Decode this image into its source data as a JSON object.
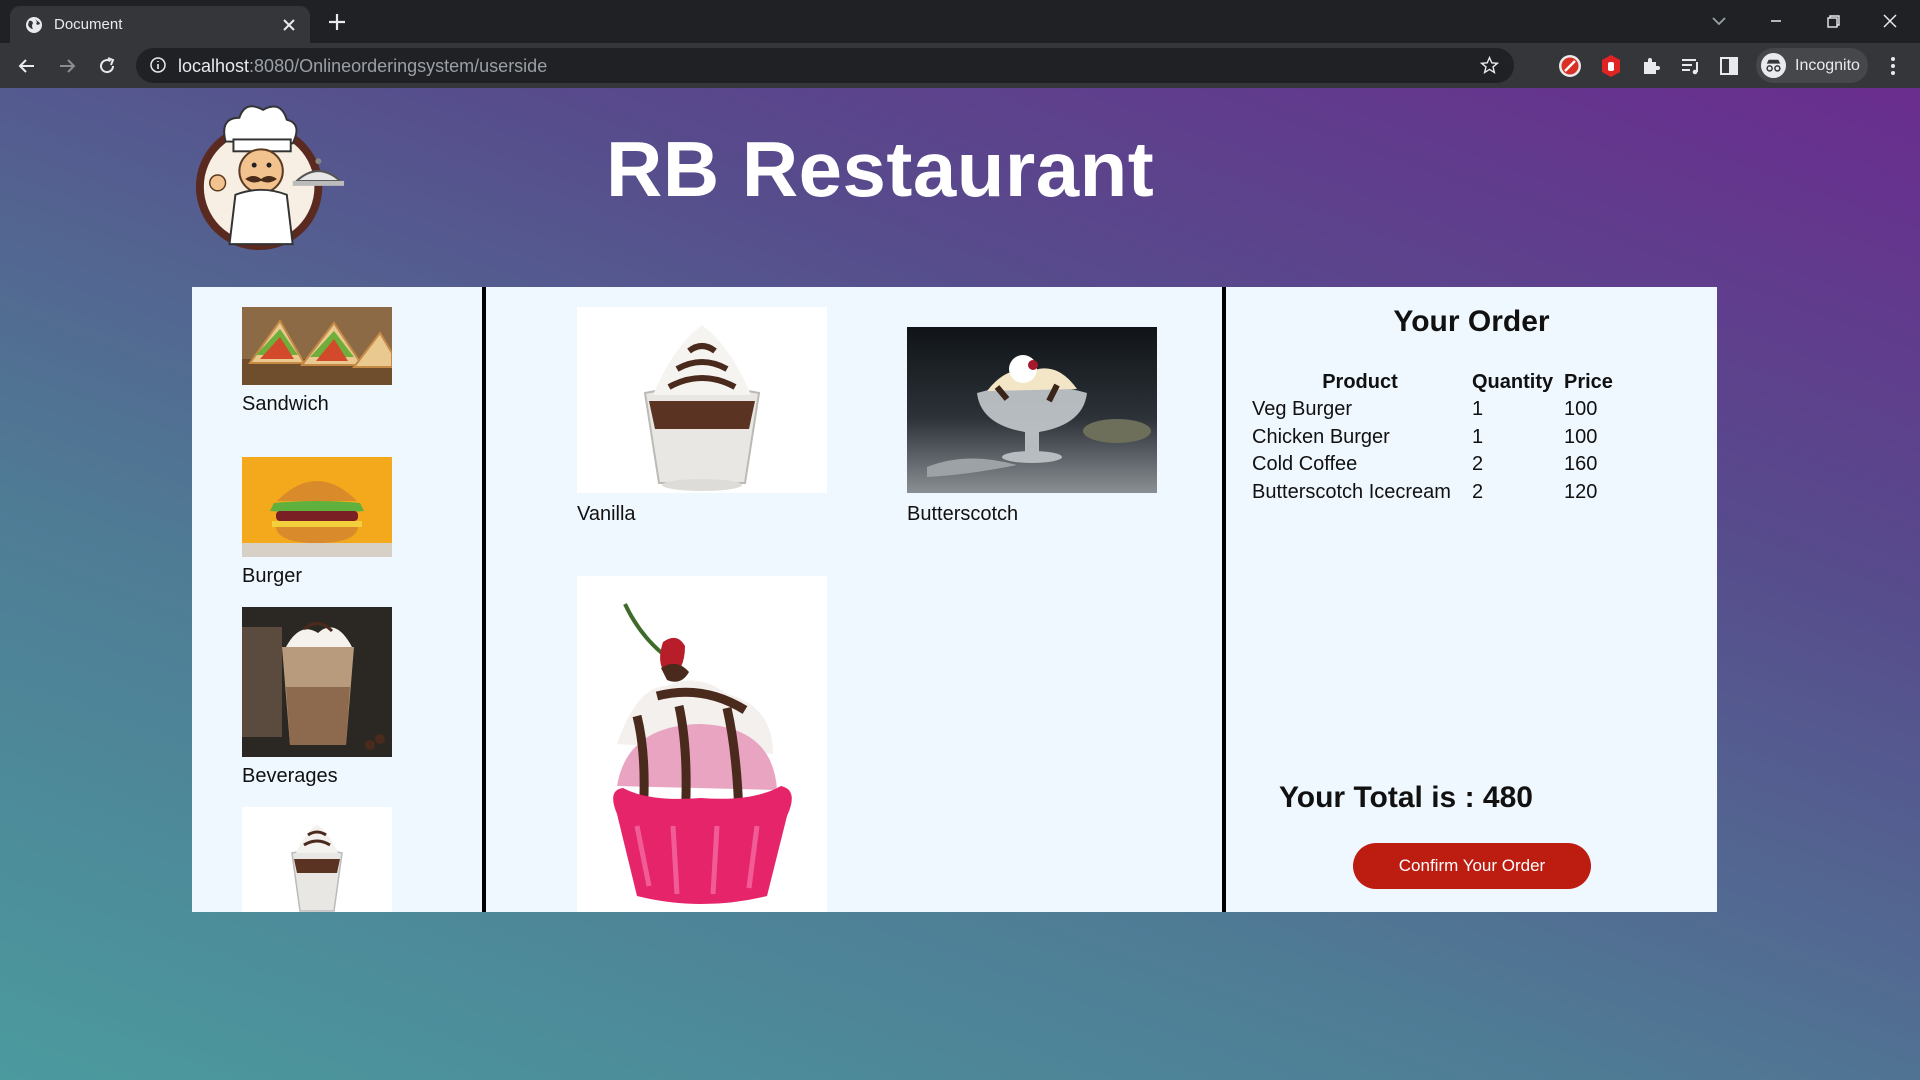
{
  "browser": {
    "tab_title": "Document",
    "url_host": "localhost",
    "url_rest": ":8080/Onlineorderingsystem/userside",
    "profile_label": "Incognito"
  },
  "site": {
    "title": "RB Restaurant"
  },
  "categories": [
    {
      "label": "Sandwich"
    },
    {
      "label": "Burger"
    },
    {
      "label": "Beverages"
    },
    {
      "label": ""
    }
  ],
  "menu_items": [
    {
      "label": "Vanilla"
    },
    {
      "label": "Butterscotch"
    },
    {
      "label": ""
    }
  ],
  "order": {
    "title": "Your Order",
    "columns": [
      "Product",
      "Quantity",
      "Price"
    ],
    "rows": [
      {
        "product": "Veg Burger",
        "quantity": "1",
        "price": "100"
      },
      {
        "product": "Chicken Burger",
        "quantity": "1",
        "price": "100"
      },
      {
        "product": "Cold Coffee",
        "quantity": "2",
        "price": "160"
      },
      {
        "product": "Butterscotch Icecream",
        "quantity": "2",
        "price": "120"
      }
    ],
    "total_text": "Your Total is : 480",
    "confirm_label": "Confirm Your Order"
  },
  "colors": {
    "confirm_button": "#bd1c10",
    "panel_bg": "#f0f8ff",
    "gradient_top_right": "#6a2d8e",
    "gradient_bottom_left": "#4b9a9e"
  }
}
